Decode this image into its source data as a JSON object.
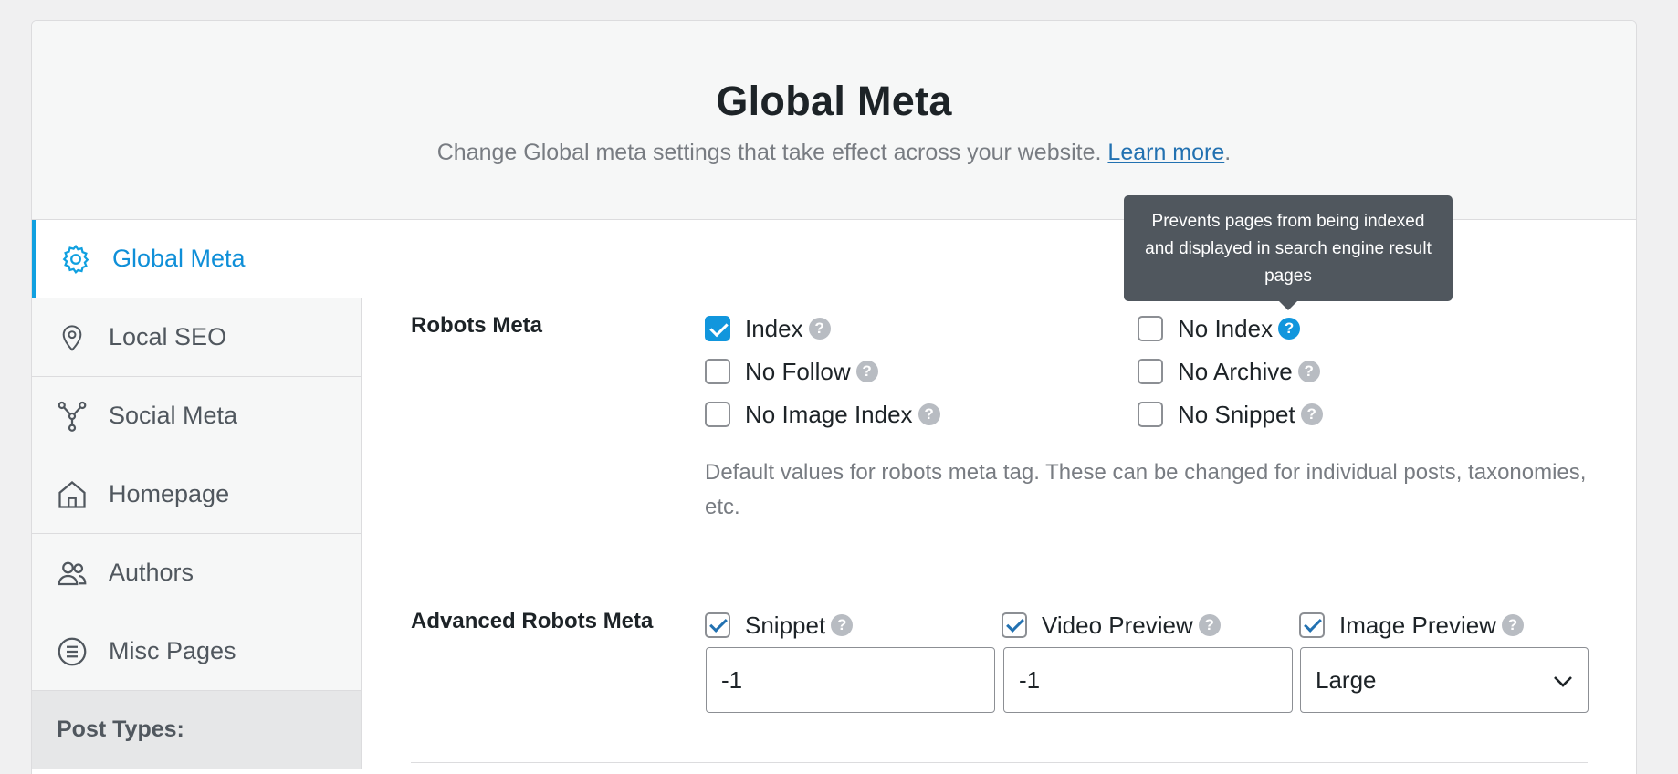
{
  "header": {
    "title": "Global Meta",
    "subtitle": "Change Global meta settings that take effect across your website.",
    "learn_more": "Learn more",
    "period": "."
  },
  "sidebar": {
    "items": [
      {
        "label": "Global Meta",
        "icon": "gear-icon",
        "active": true
      },
      {
        "label": "Local SEO",
        "icon": "location-pin-icon"
      },
      {
        "label": "Social Meta",
        "icon": "share-network-icon"
      },
      {
        "label": "Homepage",
        "icon": "home-icon"
      },
      {
        "label": "Authors",
        "icon": "users-icon"
      },
      {
        "label": "Misc Pages",
        "icon": "list-icon"
      }
    ],
    "section_label": "Post Types:"
  },
  "robots": {
    "label": "Robots Meta",
    "options": [
      {
        "label": "Index",
        "checked": true
      },
      {
        "label": "No Index",
        "checked": false
      },
      {
        "label": "No Follow",
        "checked": false
      },
      {
        "label": "No Archive",
        "checked": false
      },
      {
        "label": "No Image Index",
        "checked": false
      },
      {
        "label": "No Snippet",
        "checked": false
      }
    ],
    "description": "Default values for robots meta tag. These can be changed for individual posts, taxonomies, etc.",
    "tooltip": "Prevents pages from being indexed and displayed in search engine result pages"
  },
  "advanced": {
    "label": "Advanced Robots Meta",
    "snippet_label": "Snippet",
    "snippet_value": "-1",
    "video_label": "Video Preview",
    "video_value": "-1",
    "image_label": "Image Preview",
    "image_value": "Large"
  },
  "colors": {
    "accent": "#1196dd",
    "active_nav": "#0f8fd8",
    "tooltip_bg": "#50575e"
  }
}
